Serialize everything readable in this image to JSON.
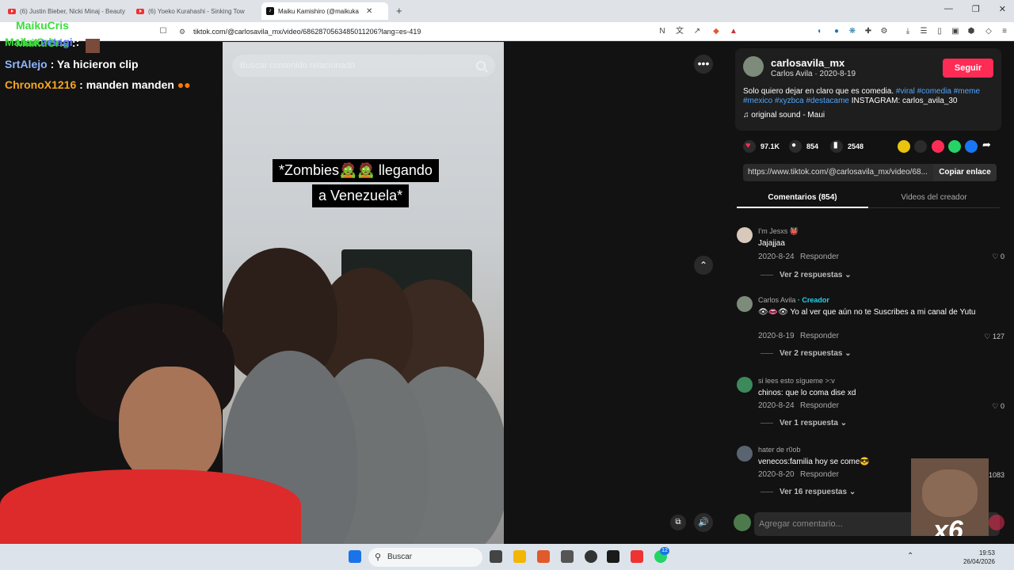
{
  "browser": {
    "tabs": [
      {
        "label": "(6) Justin Bieber, Nicki Minaj - Beauty"
      },
      {
        "label": "(6) Yoeko Kurahashi - Sinking Tow"
      },
      {
        "label": "Maiku Kamishiro (@maikuka"
      }
    ],
    "new_tab_label": "+",
    "url": "tiktok.com/@carlosavila_mx/video/6862870563485011206?lang=es-419"
  },
  "chat": {
    "lines": [
      {
        "user": "MaikuCris",
        "sep": ":",
        "text": "",
        "color": "#3ddc3d"
      },
      {
        "user": "MaikuCris",
        "sep": ":",
        "text": "",
        "color": "#3ddc3d"
      },
      {
        "user": "zetagi",
        "sep": ":",
        "text": "",
        "color": "#5b7cff"
      },
      {
        "user": "SrtAlejo",
        "sep": ":",
        "text": "Ya hicieron clip",
        "color": "#8fb6ff"
      },
      {
        "user": "ChronoX1216",
        "sep": ":",
        "text": "manden manden",
        "color": "#f5a623"
      }
    ]
  },
  "video": {
    "search_placeholder": "Buscar contenido relacionado",
    "caption_line1": "*Zombies🧟🧟 llegando",
    "caption_line2": "a Venezuela*"
  },
  "author": {
    "username": "carlosavila_mx",
    "name_date": "Carlos Avila · 2020-8-19",
    "follow_label": "Seguir",
    "description_text": "Solo quiero dejar en claro que es comedia. ",
    "hashtags": "#viral #comedia #meme #mexico #xyzbca #destacame",
    "instagram": " INSTAGRAM: carlos_avila_30",
    "sound": "original sound - Maui"
  },
  "stats": {
    "likes": "97.1K",
    "comments": "854",
    "saves": "2548"
  },
  "link": {
    "url": "https://www.tiktok.com/@carlosavila_mx/video/68...",
    "copy_label": "Copiar enlace"
  },
  "panel_tabs": {
    "comments": "Comentarios (854)",
    "creator_videos": "Videos del creador"
  },
  "comments": [
    {
      "user": "I'm Jesxs 👹",
      "text": "Jajajjaa",
      "date": "2020-8-24",
      "reply": "Responder",
      "likes": "0",
      "more": "Ver 2 respuestas ⌄"
    },
    {
      "user": "Carlos Avila",
      "badge": " · Creador",
      "text": "👁👄👁 Yo al ver que aún no te Suscribes a mi canal de Yutu",
      "date": "2020-8-19",
      "reply": "Responder",
      "likes": "127",
      "more": "Ver 2 respuestas ⌄"
    },
    {
      "user": "si lees esto sígueme >:v",
      "text": "chinos: que lo coma dise xd",
      "date": "2020-8-24",
      "reply": "Responder",
      "likes": "0",
      "more": "Ver 1 respuesta ⌄"
    },
    {
      "user": "hater de r0ob",
      "text": "venecos:familia hoy se come😎",
      "date": "2020-8-20",
      "reply": "Responder",
      "likes": "1083",
      "more": "Ver 16 respuestas ⌄"
    }
  ],
  "comment_input_placeholder": "Agregar comentario...",
  "overlay": {
    "multiplier": "x6"
  },
  "taskbar": {
    "search_label": "Buscar",
    "time": "19:53",
    "date": "26/04/2026",
    "badge": "12"
  },
  "colors": {
    "accent": "#fe2c55",
    "hashtag": "#4ea6ff",
    "creator": "#20d5ec"
  }
}
